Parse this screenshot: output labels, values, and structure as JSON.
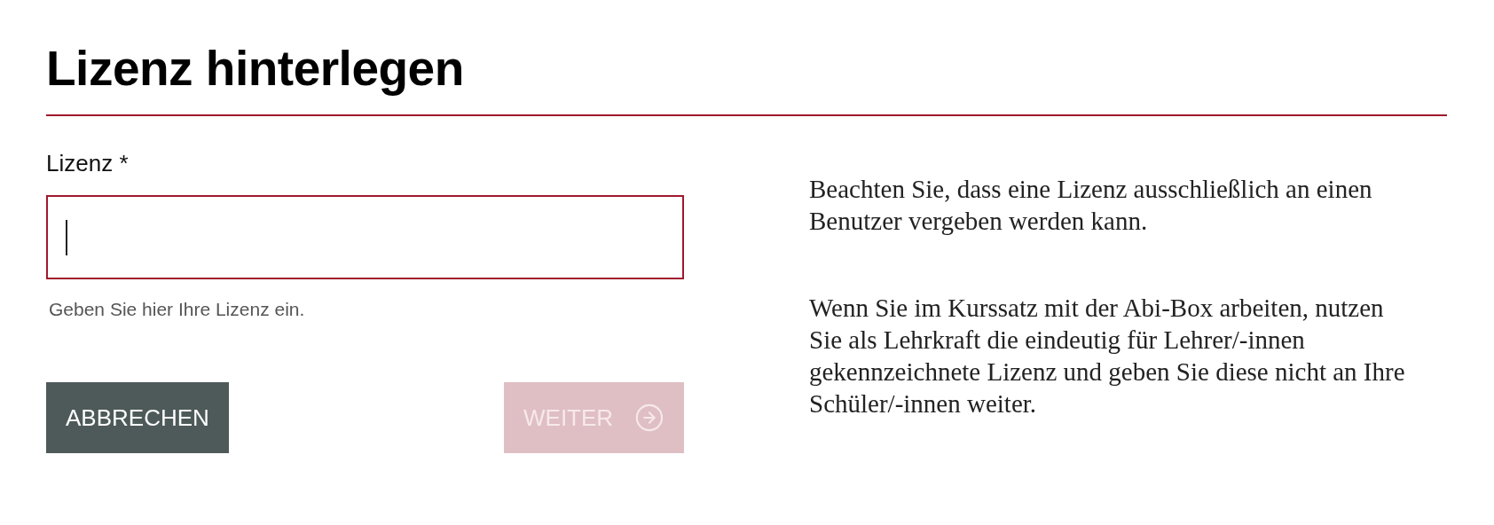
{
  "title": "Lizenz hinterlegen",
  "field": {
    "label": "Lizenz *",
    "hint": "Geben Sie hier Ihre Lizenz ein."
  },
  "buttons": [
    {
      "kind": "cancel",
      "label": "ABBRECHEN",
      "disabled": false
    },
    {
      "kind": "next",
      "label": "WEITER",
      "disabled": true
    }
  ],
  "notes": [
    "Beachten Sie, dass eine Lizenz ausschließlich an einen Benutzer vergeben werden kann.",
    "Wenn Sie im Kurssatz mit der Abi-Box arbeiten, nutzen Sie als Lehrkraft die eindeutig für Lehrer/-innen gekennzeichnete Lizenz und geben Sie diese nicht an Ihre Schüler/-innen weiter."
  ]
}
